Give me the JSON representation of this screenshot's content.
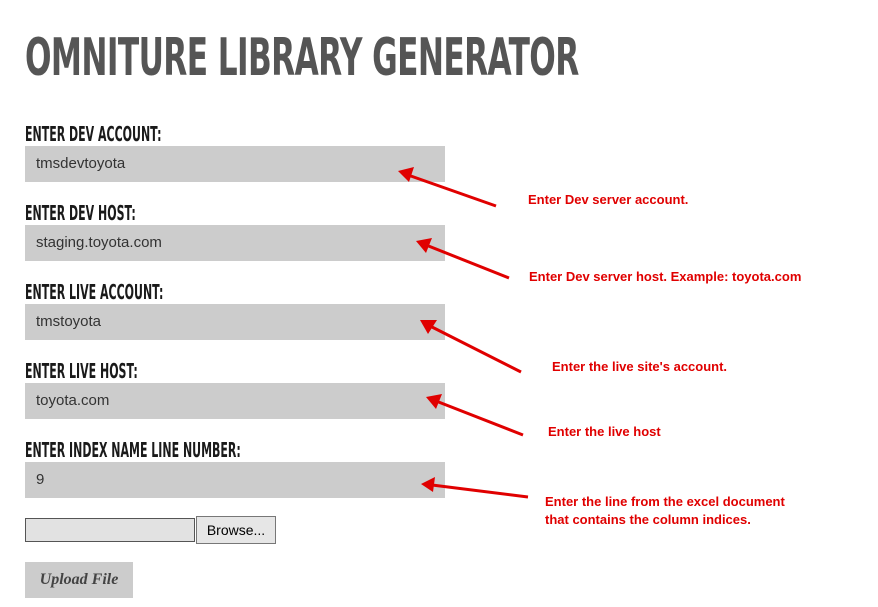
{
  "page": {
    "title": "OMNITURE LIBRARY GENERATOR"
  },
  "form": {
    "dev_account": {
      "label": "ENTER DEV ACCOUNT:",
      "value": "tmsdevtoyota"
    },
    "dev_host": {
      "label": "ENTER DEV HOST:",
      "value": "staging.toyota.com"
    },
    "live_account": {
      "label": "ENTER LIVE ACCOUNT:",
      "value": "tmstoyota"
    },
    "live_host": {
      "label": "ENTER LIVE HOST:",
      "value": "toyota.com"
    },
    "index_line": {
      "label": "ENTER INDEX NAME LINE NUMBER:",
      "value": "9"
    },
    "file": {
      "browse_label": "Browse..."
    },
    "upload_label": "Upload File"
  },
  "annotations": {
    "dev_account": "Enter Dev server account.",
    "dev_host": "Enter Dev server host. Example: toyota.com",
    "live_account": "Enter the live site's account.",
    "live_host": "Enter the live host",
    "index_line_1": "Enter the line from the excel document",
    "index_line_2": "that contains the column indices."
  },
  "colors": {
    "field_bg": "#cccccc",
    "title": "#555555",
    "annotation": "#e00000"
  }
}
